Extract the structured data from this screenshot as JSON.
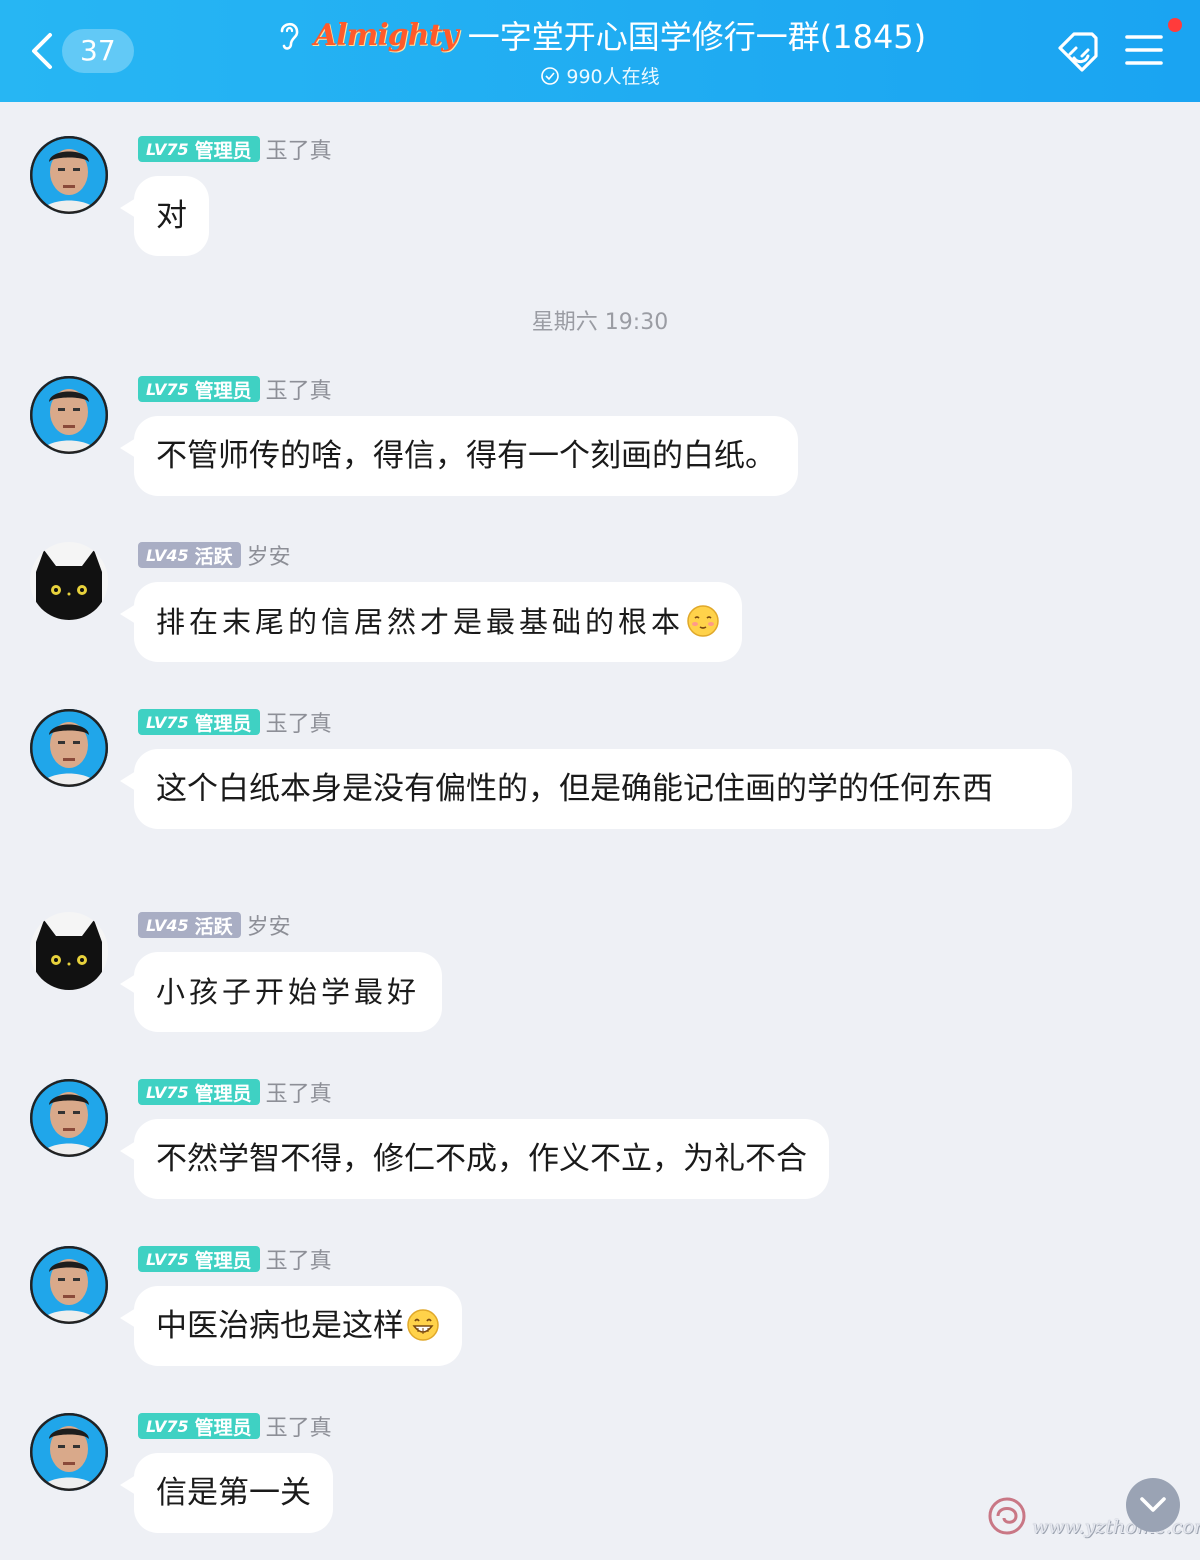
{
  "header": {
    "back_count": "37",
    "brand": "Almighty",
    "title": "一字堂开心国学修行一群(1845)",
    "online": "990人在线"
  },
  "timestamp": "星期六 19:30",
  "messages": [
    {
      "badge_level": "LV75",
      "badge_role": "管理员",
      "badge_type": "admin",
      "name": "玉了真",
      "avatar": "man",
      "text": "对"
    },
    {
      "badge_level": "LV75",
      "badge_role": "管理员",
      "badge_type": "admin",
      "name": "玉了真",
      "avatar": "man",
      "text": "不管师传的啥，得信，得有一个刻画的白纸。"
    },
    {
      "badge_level": "LV45",
      "badge_role": "活跃",
      "badge_type": "active",
      "name": "岁安",
      "avatar": "cat",
      "text": "排在末尾的信居然才是最基础的根本",
      "emoji": "blush-face"
    },
    {
      "badge_level": "LV75",
      "badge_role": "管理员",
      "badge_type": "admin",
      "name": "玉了真",
      "avatar": "man",
      "text": "这个白纸本身是没有偏性的，但是确能记住画的学的任何东西"
    },
    {
      "badge_level": "LV45",
      "badge_role": "活跃",
      "badge_type": "active",
      "name": "岁安",
      "avatar": "cat",
      "text": "小孩子开始学最好"
    },
    {
      "badge_level": "LV75",
      "badge_role": "管理员",
      "badge_type": "admin",
      "name": "玉了真",
      "avatar": "man",
      "text": "不然学智不得，修仁不成，作义不立，为礼不合"
    },
    {
      "badge_level": "LV75",
      "badge_role": "管理员",
      "badge_type": "admin",
      "name": "玉了真",
      "avatar": "man",
      "text": "中医治病也是这样",
      "emoji": "grin-face"
    },
    {
      "badge_level": "LV75",
      "badge_role": "管理员",
      "badge_type": "admin",
      "name": "玉了真",
      "avatar": "man",
      "text": "信是第一关"
    }
  ],
  "watermark": "www.yzthome.com",
  "colors": {
    "header": "#1aa4f2",
    "admin_badge": "#3fd1c3",
    "active_badge": "#a9aec4",
    "background": "#eef0f5"
  }
}
